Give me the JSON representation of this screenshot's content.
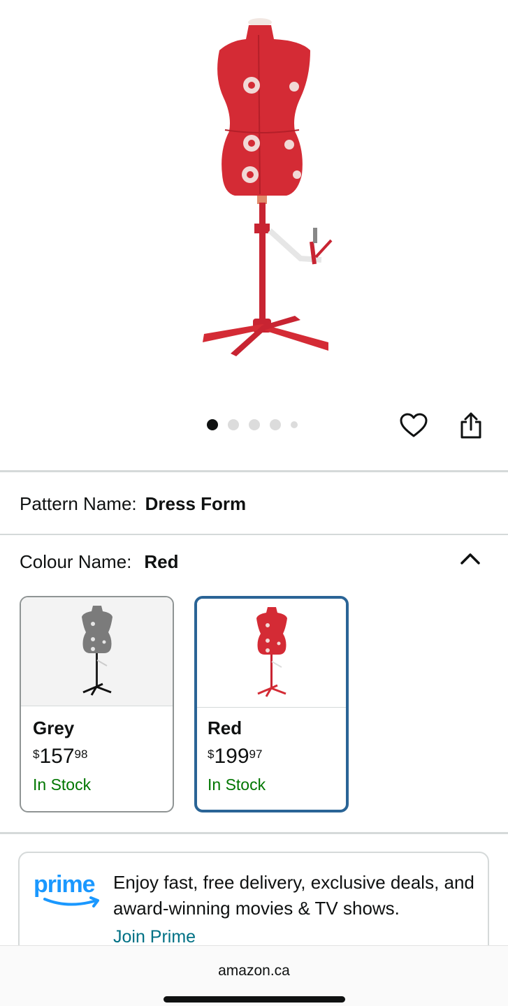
{
  "carousel": {
    "page_count": 5,
    "active_index": 0
  },
  "pattern": {
    "label": "Pattern Name:",
    "value": "Dress Form"
  },
  "colour": {
    "label": "Colour Name:",
    "value": "Red"
  },
  "swatches": [
    {
      "name": "Grey",
      "currency": "$",
      "whole": "157",
      "fraction": "98",
      "stock": "In Stock",
      "selected": false,
      "color": "#7b7b7b"
    },
    {
      "name": "Red",
      "currency": "$",
      "whole": "199",
      "fraction": "97",
      "stock": "In Stock",
      "selected": true,
      "color": "#d42b35"
    }
  ],
  "prime": {
    "logo": "prime",
    "text": "Enjoy fast, free delivery, exclusive deals, and award-winning movies & TV shows.",
    "link": "Join Prime"
  },
  "browser": {
    "url": "amazon.ca"
  },
  "icons": {
    "wishlist": "heart-icon",
    "share": "share-icon",
    "collapse": "chevron-up-icon"
  },
  "colors": {
    "accent_selected": "#2a6496",
    "stock_green": "#007600",
    "link_teal": "#007185",
    "prime_blue": "#1a98ff"
  }
}
